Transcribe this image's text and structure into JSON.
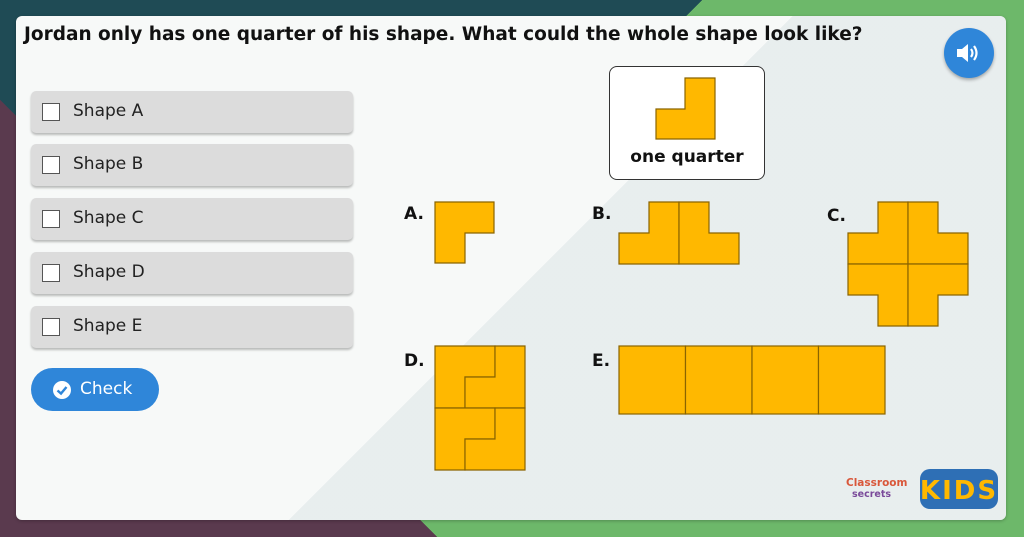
{
  "question": "Jordan only has one quarter of his shape. What could the whole shape look like?",
  "options": [
    {
      "label": "Shape A"
    },
    {
      "label": "Shape B"
    },
    {
      "label": "Shape C"
    },
    {
      "label": "Shape D"
    },
    {
      "label": "Shape E"
    }
  ],
  "check_label": "Check",
  "quarter_label": "one quarter",
  "shape_letters": [
    "A.",
    "B.",
    "C.",
    "D.",
    "E."
  ],
  "logo": {
    "brand_top": "Classroom",
    "brand_bottom": "secrets",
    "kids": "KIDS"
  },
  "colors": {
    "shape_fill": "#ffb800",
    "button_blue": "#2f86d9",
    "option_bg": "#dcdcdc"
  },
  "icons": {
    "audio": "speaker-icon",
    "check": "checkmark-circle-icon"
  }
}
